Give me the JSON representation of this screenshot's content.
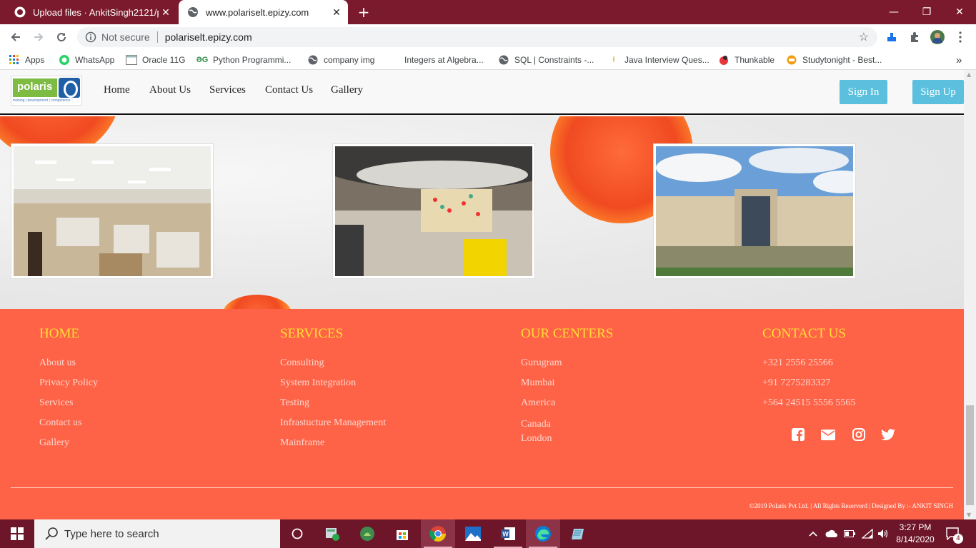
{
  "browser": {
    "tabs": [
      {
        "title": "Upload files · AnkitSingh2121/po",
        "close": "✕"
      },
      {
        "title": "www.polariselt.epizy.com",
        "close": "✕"
      }
    ],
    "new_tab": "+",
    "window_controls": {
      "minimize": "—",
      "maximize": "❐",
      "close": "✕"
    },
    "address": {
      "security": "Not secure",
      "url": "polariselt.epizy.com"
    },
    "bookmarks": [
      {
        "label": "Apps",
        "icon": "apps-grid-icon"
      },
      {
        "label": "WhatsApp",
        "icon": "whatsapp-icon"
      },
      {
        "label": "Oracle 11G",
        "icon": "page-icon"
      },
      {
        "label": "Python Programmi...",
        "icon": "gfg-icon"
      },
      {
        "label": "company img",
        "icon": "globe-icon"
      },
      {
        "label": "Integers at Algebra...",
        "icon": "blank-icon"
      },
      {
        "label": "SQL | Constraints -...",
        "icon": "globe-icon"
      },
      {
        "label": "Java Interview Ques...",
        "icon": "flame-icon"
      },
      {
        "label": "Thunkable",
        "icon": "thunkable-icon"
      },
      {
        "label": "Studytonight - Best...",
        "icon": "studytonight-icon"
      }
    ],
    "bookmarks_more": "»"
  },
  "site": {
    "logo": {
      "word": "polaris",
      "tagline": "training | development | competence"
    },
    "nav": [
      "Home",
      "About Us",
      "Services",
      "Contact Us",
      "Gallery"
    ],
    "signin": "Sign In",
    "signup": "Sign Up",
    "footer": {
      "home": {
        "heading": "HOME",
        "links": [
          "About us",
          "Privacy Policy",
          "Services",
          "Contact us",
          "Gallery"
        ]
      },
      "services": {
        "heading": "SERVICES",
        "links": [
          "Consulting",
          "System Integration",
          "Testing",
          "Infrastucture Management",
          "Mainframe"
        ]
      },
      "centers": {
        "heading": "OUR CENTERS",
        "links": [
          "Gurugram",
          "Mumbai",
          "America"
        ],
        "extra": [
          "Canada",
          "London"
        ]
      },
      "contact": {
        "heading": "CONTACT US",
        "phones": [
          "+321 2556 25566",
          "+91 7275283327",
          "+564 24515 5556 5565"
        ]
      },
      "copyright": "©2019 Polaris Pvt Ltd. | All Rights Reserverd | Designed By :- ANKIT SINGH",
      "colors": {
        "background": "#ff6347",
        "heading": "#ffe033"
      }
    }
  },
  "taskbar": {
    "search_placeholder": "Type here to search",
    "time": "3:27 PM",
    "date": "8/14/2020",
    "notifications": "4"
  }
}
